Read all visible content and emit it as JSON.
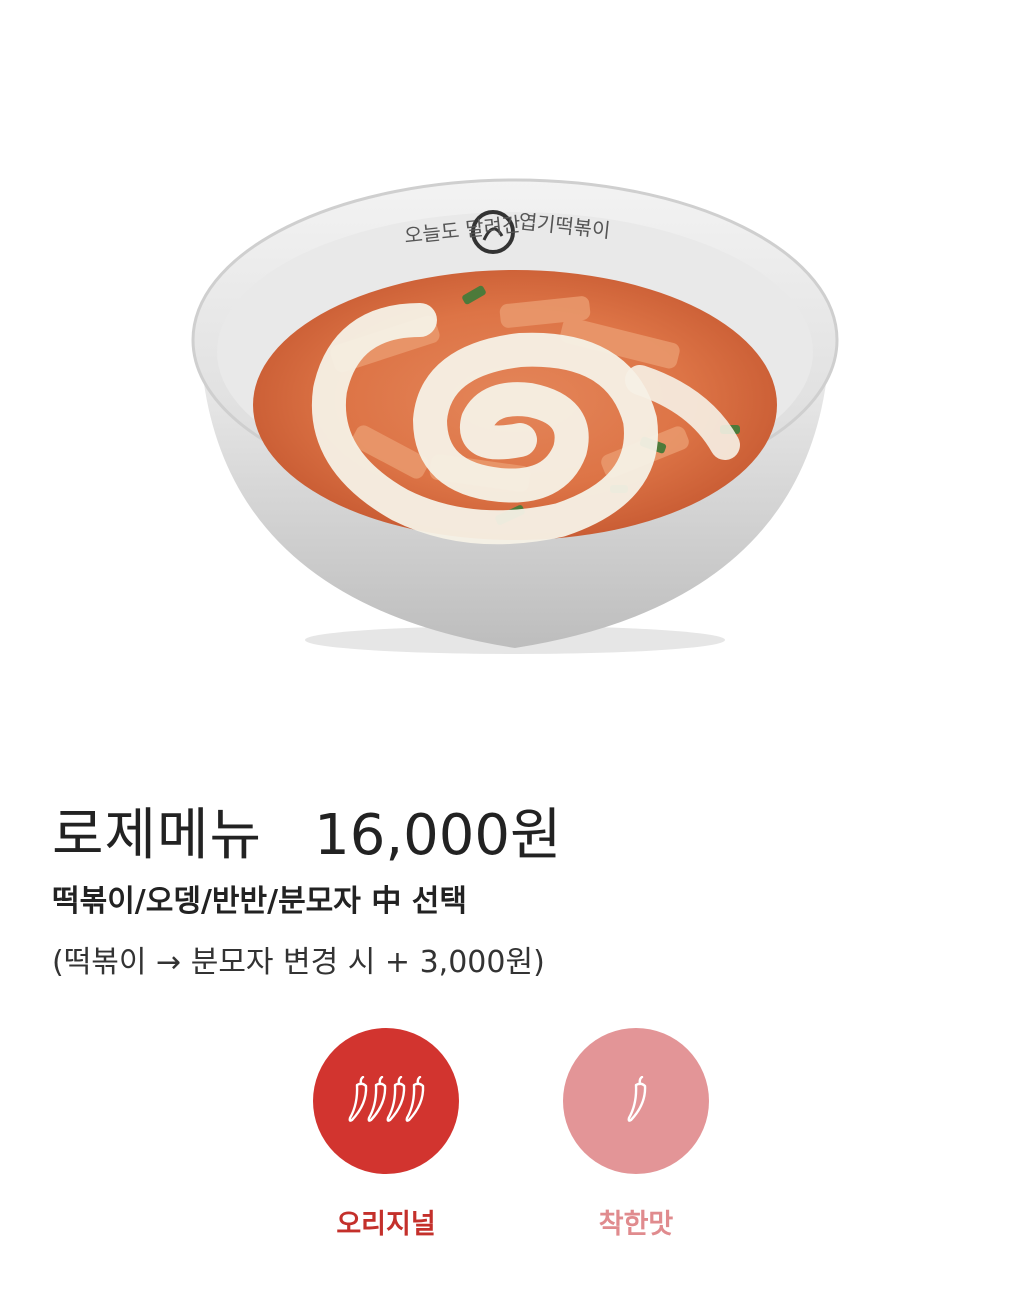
{
  "product": {
    "image_alt": "로제 떡볶이",
    "bowl_logo_text": "오늘도 달려간 엽기떡볶이",
    "name": "로제메뉴",
    "price": "16,000원",
    "subtitle": "떡볶이/오뎅/반반/분모자 中 선택",
    "note": "(떡볶이 → 분모자 변경 시 + 3,000원)"
  },
  "spice_options": [
    {
      "label": "오리지널",
      "peppers": 4,
      "circle_color": "#d2342f",
      "label_color": "#c4302b",
      "icon": "pepper-icon"
    },
    {
      "label": "착한맛",
      "peppers": 1,
      "circle_color": "#e39597",
      "label_color": "#e08b8e",
      "icon": "pepper-icon"
    }
  ],
  "colors": {
    "text": "#222222",
    "background": "#ffffff"
  }
}
